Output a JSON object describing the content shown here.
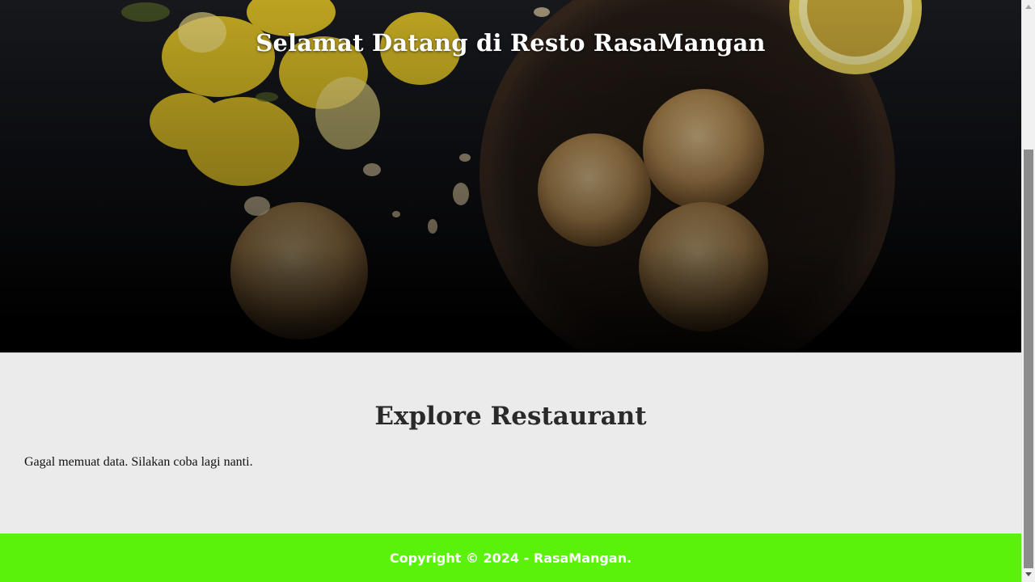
{
  "hero": {
    "title": "Selamat Datang di Resto RasaMangan"
  },
  "main": {
    "section_title": "Explore Restaurant",
    "error_message": "Gagal memuat data. Silakan coba lagi nanti."
  },
  "footer": {
    "copyright": "Copyright © 2024 - RasaMangan."
  },
  "colors": {
    "footer_bg": "#5af10b",
    "main_bg": "#ebebeb",
    "hero_bg": "#101115"
  }
}
